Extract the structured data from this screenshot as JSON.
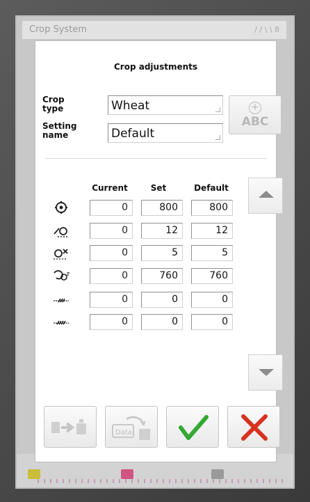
{
  "background": {
    "window_title": "Crop System",
    "title_right": "/ / \\ \\ 8"
  },
  "dialog": {
    "title": "Crop adjustments",
    "crop_type_label": "Crop\ntype",
    "crop_type_value": "Wheat",
    "setting_name_label": "Setting\nname",
    "setting_name_value": "Default"
  },
  "table": {
    "headers": [
      "Current",
      "Set",
      "Default"
    ],
    "rows": [
      {
        "icon": "cylinder-speed-icon",
        "current": "0",
        "set": "800",
        "default": "800"
      },
      {
        "icon": "concave-clearance-icon",
        "current": "0",
        "set": "12",
        "default": "12"
      },
      {
        "icon": "sieve-icon",
        "current": "0",
        "set": "5",
        "default": "5"
      },
      {
        "icon": "fan-speed-icon",
        "current": "0",
        "set": "760",
        "default": "760"
      },
      {
        "icon": "upper-sieve-icon",
        "current": "0",
        "set": "0",
        "default": "0"
      },
      {
        "icon": "lower-sieve-icon",
        "current": "0",
        "set": "0",
        "default": "0"
      }
    ]
  },
  "colors": {
    "accept": "#35a833",
    "cancel": "#d6321e",
    "disabled": "#c6c6c6"
  }
}
